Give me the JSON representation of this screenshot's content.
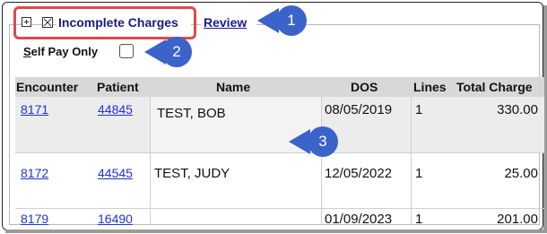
{
  "header": {
    "title": "Incomplete Charges",
    "review_link": "Review",
    "self_pay_label": "Self Pay Only"
  },
  "table": {
    "columns": [
      "Encounter",
      "Patient",
      "Name",
      "DOS",
      "Lines",
      "Total Charge"
    ],
    "rows": [
      {
        "encounter": "8171",
        "patient": "44845",
        "name": "TEST, BOB",
        "dos": "08/05/2019",
        "lines": "1",
        "total": "330.00"
      },
      {
        "encounter": "8172",
        "patient": "44545",
        "name": "TEST, JUDY",
        "dos": "12/05/2022",
        "lines": "1",
        "total": "25.00"
      },
      {
        "encounter": "8179",
        "patient": "16490",
        "name": "",
        "dos": "01/09/2023",
        "lines": "1",
        "total": "201.00"
      }
    ]
  },
  "callouts": [
    "1",
    "2",
    "3"
  ],
  "colors": {
    "callout": "#3b63c9",
    "highlight": "#e0484e",
    "link": "#2233cc",
    "header_bg": "#d8d8d8"
  }
}
